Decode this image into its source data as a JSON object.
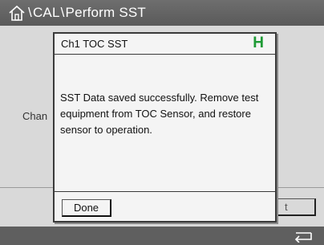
{
  "titlebar": {
    "home_icon": "home-icon",
    "crumbs": [
      "CAL",
      "Perform SST"
    ],
    "separator": "\\"
  },
  "background": {
    "channel_label": "Chan",
    "right_button_label": "t"
  },
  "dialog": {
    "title": "Ch1 TOC SST",
    "status_indicator": "H",
    "status_color": "#1e9a35",
    "message": "SST Data saved successfully. Remove test equipment from TOC Sensor, and restore sensor to operation.",
    "done_label": "Done"
  },
  "bottombar": {
    "back_icon": "back-arrow-icon"
  }
}
